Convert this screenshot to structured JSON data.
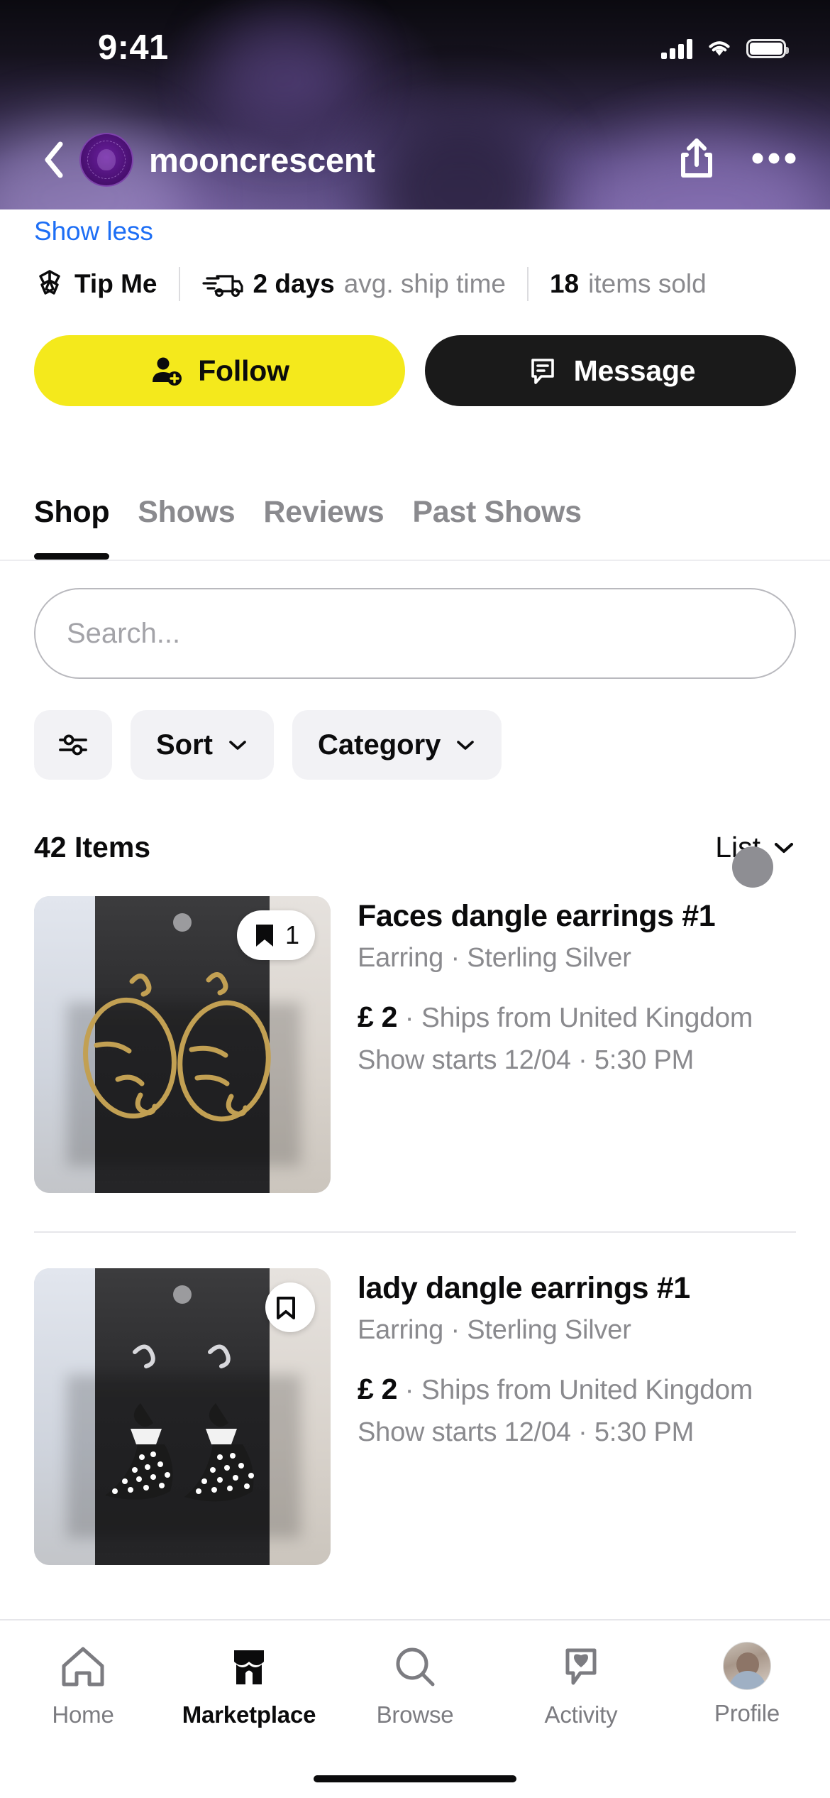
{
  "status_bar": {
    "time": "9:41",
    "cellular_icon": "signal-bars-icon",
    "wifi_icon": "wifi-icon",
    "battery_icon": "battery-icon"
  },
  "nav": {
    "back_icon": "chevron-left-icon",
    "avatar_icon": "seller-avatar",
    "title": "mooncrescent",
    "share_icon": "share-icon",
    "more_icon": "more-horizontal-icon"
  },
  "shop_info": {
    "show_less_label": "Show less",
    "tip_icon": "tip-me-icon",
    "tip_label": "Tip Me",
    "ship_icon": "shipping-truck-icon",
    "ship_value": "2 days",
    "ship_label": "avg. ship time",
    "sold_value": "18",
    "sold_label": "items sold"
  },
  "actions": {
    "follow_icon": "person-add-icon",
    "follow_label": "Follow",
    "follow_color": "#f4e91c",
    "message_icon": "message-bubble-icon",
    "message_label": "Message",
    "message_color": "#1a1a1a"
  },
  "tabs": {
    "active": "Shop",
    "items": [
      {
        "label": "Shop"
      },
      {
        "label": "Shows"
      },
      {
        "label": "Reviews"
      },
      {
        "label": "Past Shows"
      }
    ]
  },
  "search": {
    "placeholder": "Search...",
    "value": ""
  },
  "filters": {
    "filter_icon": "sliders-filter-icon",
    "sort_label": "Sort",
    "sort_caret": "chevron-down-icon",
    "category_label": "Category",
    "category_caret": "chevron-down-icon"
  },
  "results": {
    "count_label": "42 Items",
    "view_mode": "List",
    "view_caret": "chevron-down-icon"
  },
  "products": [
    {
      "title": "Faces dangle earrings #1",
      "subtitle": "Earring · Sterling Silver",
      "price": "£ 2",
      "price_sep": "·",
      "shipping": "Ships from United Kingdom",
      "show_time": "Show starts 12/04 · 5:30 PM",
      "bookmark_icon": "bookmark-filled-icon",
      "bookmark_count": "1",
      "image_alt": "gold-face-outline-earrings"
    },
    {
      "title": "lady dangle earrings #1",
      "subtitle": "Earring · Sterling Silver",
      "price": "£ 2",
      "price_sep": "·",
      "shipping": "Ships from United Kingdom",
      "show_time": "Show starts 12/04 · 5:30 PM",
      "bookmark_icon": "bookmark-outline-icon",
      "bookmark_count": "",
      "image_alt": "polka-dot-dress-lady-earrings"
    }
  ],
  "bottom_nav": {
    "active": "Marketplace",
    "items": [
      {
        "label": "Home",
        "icon": "home-icon"
      },
      {
        "label": "Marketplace",
        "icon": "marketplace-storefront-icon"
      },
      {
        "label": "Browse",
        "icon": "search-magnifier-icon"
      },
      {
        "label": "Activity",
        "icon": "heart-bubble-icon"
      },
      {
        "label": "Profile",
        "icon": "profile-avatar-icon"
      }
    ]
  }
}
